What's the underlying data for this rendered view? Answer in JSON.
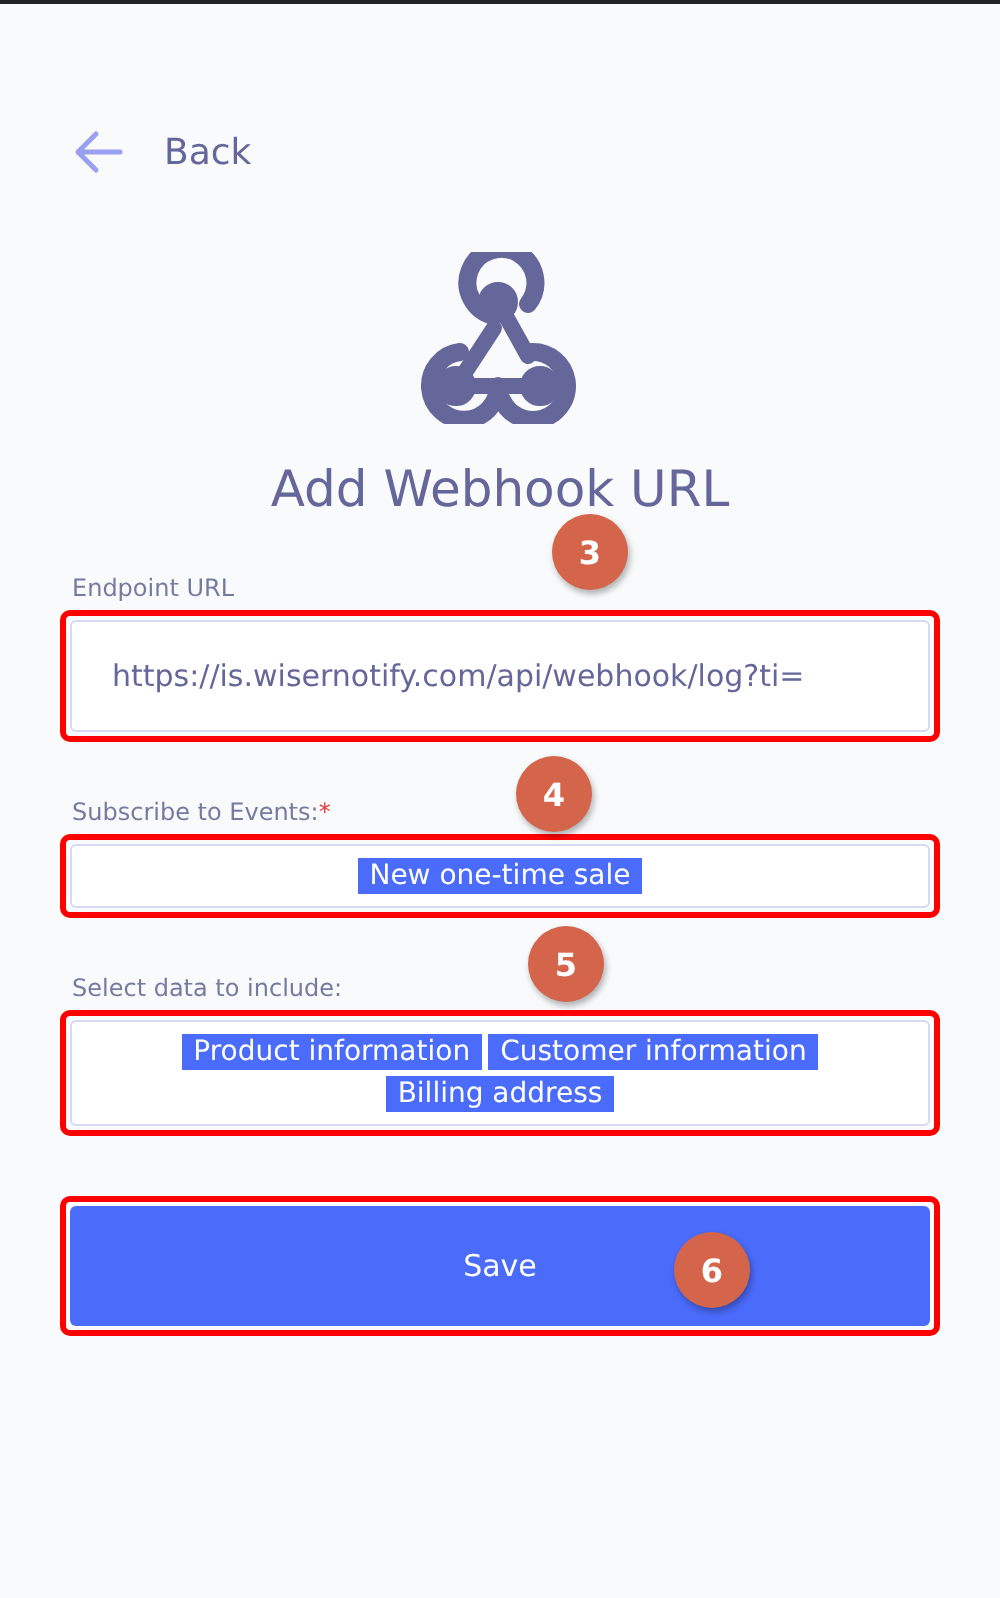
{
  "back": {
    "label": "Back"
  },
  "title": "Add Webhook URL",
  "fields": [
    {
      "kind": "text",
      "label": "Endpoint URL",
      "value": "https://is.wisernotify.com/api/webhook/log?ti=",
      "callout": "3",
      "highlighted": true
    },
    {
      "kind": "tags",
      "label": "Subscribe to Events:",
      "required_mark": "*",
      "tags": [
        "New one-time sale"
      ],
      "callout": "4",
      "highlighted": true
    },
    {
      "kind": "tags",
      "label": "Select data to include:",
      "tags": [
        "Product information",
        "Customer information",
        "Billing address"
      ],
      "callout": "5",
      "highlighted": true
    }
  ],
  "save_button": {
    "label": "Save",
    "callout": "6",
    "highlighted": true
  }
}
